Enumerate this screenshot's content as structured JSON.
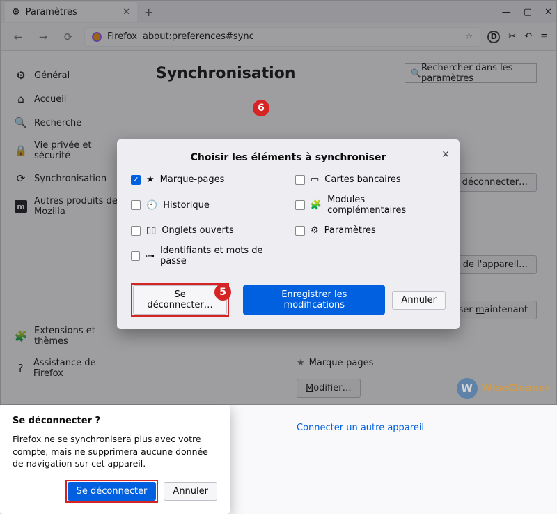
{
  "titlebar": {
    "tab_label": "Paramètres"
  },
  "toolbar": {
    "identity": "Firefox",
    "url": "about:preferences#sync"
  },
  "sidebar": {
    "items": [
      {
        "label": "Général"
      },
      {
        "label": "Accueil"
      },
      {
        "label": "Recherche"
      },
      {
        "label": "Vie privée et sécurité"
      },
      {
        "label": "Synchronisation"
      },
      {
        "label": "Autres produits de Mozilla"
      }
    ],
    "bottom": [
      {
        "label": "Extensions et thèmes"
      },
      {
        "label": "Assistance de Firefox"
      }
    ]
  },
  "main": {
    "heading": "Synchronisation",
    "search_placeholder": "Rechercher dans les paramètres",
    "disconnect_btn": "Se déconnecter…",
    "device_btn": "Modifier le nom de l'appareil…",
    "sync_now_btn": "Synchroniser maintenant",
    "bookmark_label": "Marque-pages",
    "modifier_btn": "Modifier…",
    "connect_link": "Connecter un autre appareil"
  },
  "dlg_sync": {
    "title": "Choisir les éléments à synchroniser",
    "opts": [
      {
        "label": "Marque-pages",
        "checked": true,
        "icon": "★"
      },
      {
        "label": "Cartes bancaires",
        "checked": false,
        "icon": "💳"
      },
      {
        "label": "Historique",
        "checked": false,
        "icon": "🕘"
      },
      {
        "label": "Modules complémentaires",
        "checked": false,
        "icon": "🧩"
      },
      {
        "label": "Onglets ouverts",
        "checked": false,
        "icon": "▯▯"
      },
      {
        "label": "Paramètres",
        "checked": false,
        "icon": "⚙"
      },
      {
        "label": "Identifiants et mots de passe",
        "checked": false,
        "icon": "⊶"
      }
    ],
    "disconnect": "Se déconnecter…",
    "save": "Enregistrer les modifications",
    "cancel": "Annuler"
  },
  "dlg_confirm": {
    "title": "Se déconnecter ?",
    "msg": "Firefox ne se synchronisera plus avec votre compte, mais ne supprimera aucune donnée de navigation sur cet appareil.",
    "confirm": "Se déconnecter",
    "cancel": "Annuler"
  },
  "badges": {
    "five": "5",
    "six": "6"
  },
  "watermark": "WiseCleaner"
}
